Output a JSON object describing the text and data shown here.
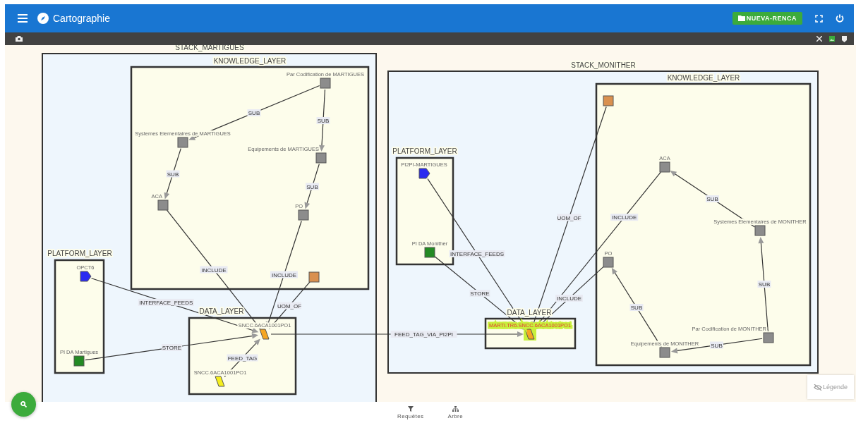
{
  "header": {
    "title": "Cartographie",
    "button": "NUEVA-RENCA"
  },
  "groups": [
    {
      "label": "STACK_MARTIGUES",
      "kind": "stack"
    },
    {
      "label": "KNOWLEDGE_LAYER",
      "kind": "layer"
    },
    {
      "label": "PLATFORM_LAYER",
      "kind": "layer"
    },
    {
      "label": "DATA_LAYER",
      "kind": "layer"
    },
    {
      "label": "STACK_MONITHER",
      "kind": "stack"
    },
    {
      "label": "KNOWLEDGE_LAYER",
      "kind": "layer"
    },
    {
      "label": "PLATFORM_LAYER",
      "kind": "layer"
    },
    {
      "label": "DATA_LAYER",
      "kind": "layer"
    }
  ],
  "nodes": [
    {
      "label": "Par Codification de MARTIGUES",
      "kind": "square",
      "color": "#8c8c8c",
      "highlighted": false
    },
    {
      "label": "Systemes Elementaires de MARTIGUES",
      "kind": "square",
      "color": "#8c8c8c",
      "highlighted": false
    },
    {
      "label": "Equipements de MARTIGUES",
      "kind": "square",
      "color": "#8c8c8c",
      "highlighted": false
    },
    {
      "label": "ACA",
      "kind": "square",
      "color": "#8c8c8c",
      "highlighted": false
    },
    {
      "label": "PO",
      "kind": "square",
      "color": "#8c8c8c",
      "highlighted": false
    },
    {
      "kind": "square",
      "color": "#d9904f",
      "highlighted": false
    },
    {
      "label": "OPCT6",
      "kind": "pentagon",
      "color": "#2b2bf0",
      "highlighted": false
    },
    {
      "label": "PI DA Martigues",
      "kind": "square",
      "color": "#238a23",
      "highlighted": false
    },
    {
      "label": "SNCC.6ACA1001PO1",
      "kind": "parallelogram",
      "color": "#f5a623",
      "highlighted": false
    },
    {
      "label": "SNCC.6ACA1001PO1",
      "kind": "parallelogram",
      "color": "#f5ee1e",
      "highlighted": false
    },
    {
      "label": "PI2PI-MARTIGUES",
      "kind": "pentagon",
      "color": "#2b2bf0",
      "highlighted": false
    },
    {
      "label": "PI DA Monither",
      "kind": "square",
      "color": "#238a23",
      "highlighted": false
    },
    {
      "label": "MARTI.TR6.SNCC.6ACA1001PO1",
      "kind": "parallelogram",
      "color": "#f5a623",
      "highlighted": true
    },
    {
      "kind": "square",
      "color": "#d9904f",
      "highlighted": false
    },
    {
      "label": "ACA",
      "kind": "square",
      "color": "#8c8c8c",
      "highlighted": false
    },
    {
      "label": "Systemes Elementaires de MONITHER",
      "kind": "square",
      "color": "#8c8c8c",
      "highlighted": false
    },
    {
      "label": "PO",
      "kind": "square",
      "color": "#8c8c8c",
      "highlighted": false
    },
    {
      "label": "Par Codification de MONITHER",
      "kind": "square",
      "color": "#8c8c8c",
      "highlighted": false
    },
    {
      "label": "Equipements de MONITHER",
      "kind": "square",
      "color": "#8c8c8c",
      "highlighted": false
    }
  ],
  "edges": [
    {
      "label": "SUB"
    },
    {
      "label": "SUB"
    },
    {
      "label": "SUB"
    },
    {
      "label": "SUB"
    },
    {
      "label": "INCLUDE"
    },
    {
      "label": "INCLUDE"
    },
    {
      "label": "INTERFACE_FEEDS"
    },
    {
      "label": "UOM_OF"
    },
    {
      "label": "STORE"
    },
    {
      "label": "FEED_TAG"
    },
    {
      "label": "FEED_TAG_VIA_PI2PI"
    },
    {
      "label": "INTERFACE_FEEDS"
    },
    {
      "label": "STORE"
    },
    {
      "label": "UOM_OF"
    },
    {
      "label": "INCLUDE"
    },
    {
      "label": "INCLUDE"
    },
    {
      "label": "SUB"
    },
    {
      "label": "SUB"
    },
    {
      "label": "SUB"
    },
    {
      "label": "SUB"
    }
  ],
  "legend_button": "Légende",
  "bottom_nav": [
    {
      "label": "Requêtes",
      "kind": "filter"
    },
    {
      "label": "Arbre",
      "kind": "tree"
    }
  ]
}
